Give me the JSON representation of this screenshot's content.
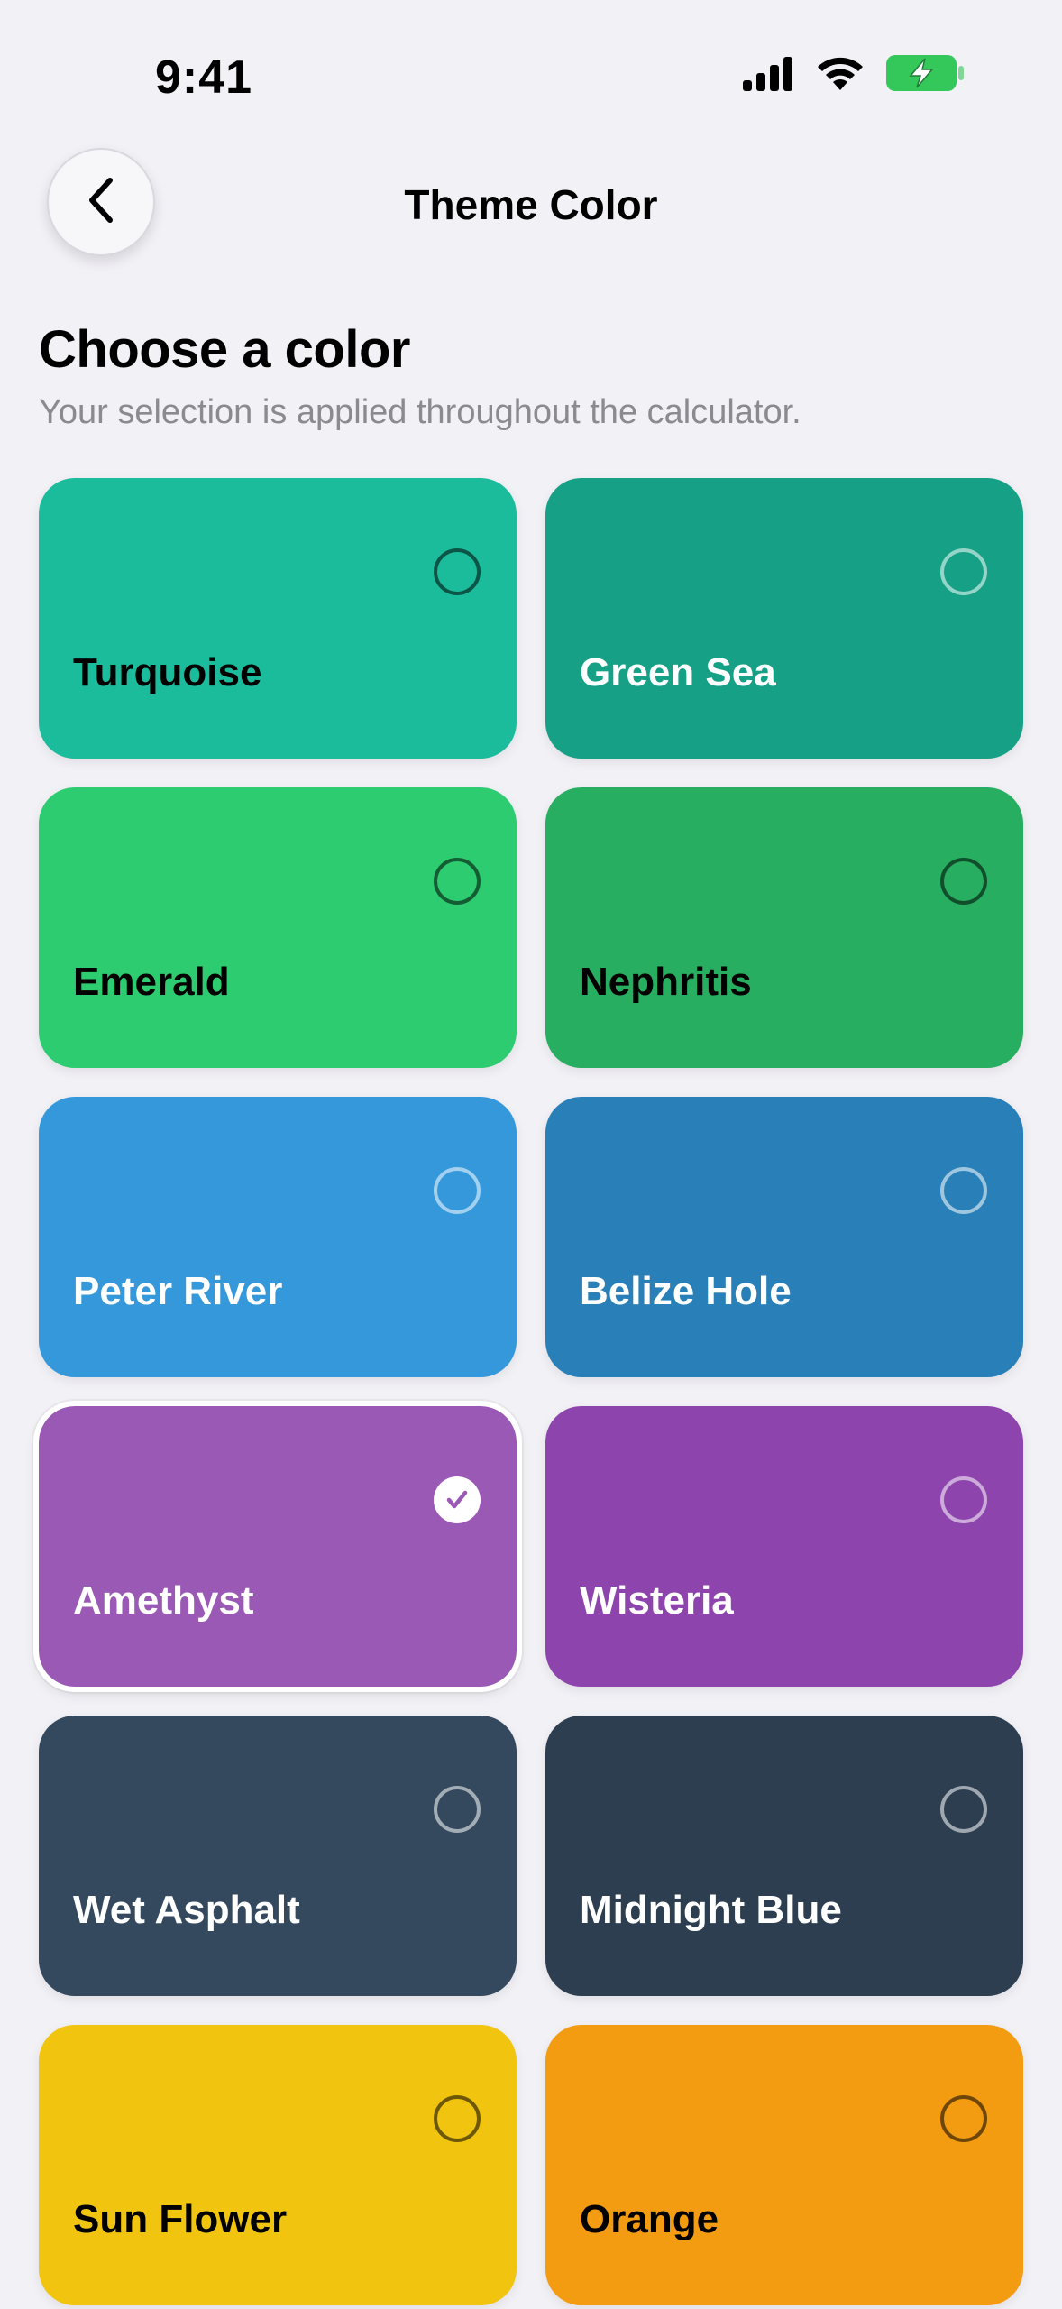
{
  "status_bar": {
    "time": "9:41"
  },
  "header": {
    "title": "Theme Color",
    "back_icon": "chevron-left-icon"
  },
  "intro": {
    "heading": "Choose a color",
    "subtitle": "Your selection is applied throughout the calculator."
  },
  "colors": [
    {
      "name": "Turquoise",
      "hex": "#1ABC9C",
      "text": "#000000",
      "selected": false
    },
    {
      "name": "Green Sea",
      "hex": "#16A085",
      "text": "#FFFFFF",
      "selected": false
    },
    {
      "name": "Emerald",
      "hex": "#2ECC71",
      "text": "#000000",
      "selected": false
    },
    {
      "name": "Nephritis",
      "hex": "#27AE60",
      "text": "#000000",
      "selected": false
    },
    {
      "name": "Peter River",
      "hex": "#3498DB",
      "text": "#FFFFFF",
      "selected": false
    },
    {
      "name": "Belize Hole",
      "hex": "#2980B9",
      "text": "#FFFFFF",
      "selected": false
    },
    {
      "name": "Amethyst",
      "hex": "#9B59B6",
      "text": "#FFFFFF",
      "selected": true
    },
    {
      "name": "Wisteria",
      "hex": "#8E44AD",
      "text": "#FFFFFF",
      "selected": false
    },
    {
      "name": "Wet Asphalt",
      "hex": "#34495E",
      "text": "#FFFFFF",
      "selected": false
    },
    {
      "name": "Midnight Blue",
      "hex": "#2C3E50",
      "text": "#FFFFFF",
      "selected": false
    },
    {
      "name": "Sun Flower",
      "hex": "#F1C40F",
      "text": "#000000",
      "selected": false
    },
    {
      "name": "Orange",
      "hex": "#F39C12",
      "text": "#000000",
      "selected": false
    }
  ],
  "accent": "#9B59B6",
  "battery_color": "#34C759"
}
